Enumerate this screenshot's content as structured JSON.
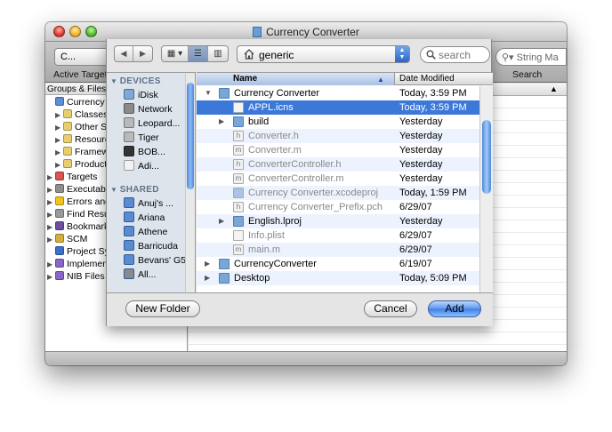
{
  "window": {
    "title": "Currency Converter"
  },
  "toolbar": {
    "target_popup": "C...",
    "target_label": "Active Target",
    "search_field_placeholder": "String Ma",
    "search_label": "Search"
  },
  "groups": {
    "header": "Groups & Files",
    "items": [
      {
        "label": "Currency Converter",
        "indent": 0,
        "color": "#5b8ed6",
        "tri": ""
      },
      {
        "label": "Classes",
        "indent": 1,
        "color": "#e8cf6e",
        "tri": "▶"
      },
      {
        "label": "Other Sources",
        "indent": 1,
        "color": "#e8cf6e",
        "tri": "▶"
      },
      {
        "label": "Resources",
        "indent": 1,
        "color": "#e8cf6e",
        "tri": "▶"
      },
      {
        "label": "Frameworks",
        "indent": 1,
        "color": "#e8cf6e",
        "tri": "▶"
      },
      {
        "label": "Products",
        "indent": 1,
        "color": "#e8cf6e",
        "tri": "▶"
      },
      {
        "label": "Targets",
        "indent": 0,
        "color": "#d9534f",
        "tri": "▶"
      },
      {
        "label": "Executables",
        "indent": 0,
        "color": "#8e8e8e",
        "tri": "▶"
      },
      {
        "label": "Errors and Warnings",
        "indent": 0,
        "color": "#f0c419",
        "tri": "▶"
      },
      {
        "label": "Find Results",
        "indent": 0,
        "color": "#999999",
        "tri": "▶"
      },
      {
        "label": "Bookmarks",
        "indent": 0,
        "color": "#6d4ea0",
        "tri": "▶"
      },
      {
        "label": "SCM",
        "indent": 0,
        "color": "#d4b03a",
        "tri": "▶"
      },
      {
        "label": "Project Symbols",
        "indent": 0,
        "color": "#3c6fc7",
        "tri": ""
      },
      {
        "label": "Implementation Files",
        "indent": 0,
        "color": "#8a65c7",
        "tri": "▶"
      },
      {
        "label": "NIB Files",
        "indent": 0,
        "color": "#8a65c7",
        "tri": "▶"
      }
    ]
  },
  "sheet": {
    "nav": {
      "back": "◀",
      "forward": "▶"
    },
    "view_modes": [
      "icon",
      "list",
      "column"
    ],
    "path": "generic",
    "search_placeholder": "search",
    "sidebar": {
      "devices_header": "DEVICES",
      "devices": [
        {
          "label": "iDisk",
          "color": "#7fa8d8",
          "eject": false
        },
        {
          "label": "Network",
          "color": "#8a8a8a",
          "eject": false
        },
        {
          "label": "Leopard...",
          "color": "#b9b9b9",
          "eject": false
        },
        {
          "label": "Tiger",
          "color": "#b9b9b9",
          "eject": false
        },
        {
          "label": "BOB...",
          "color": "#333333",
          "eject": true
        },
        {
          "label": "Adi...",
          "color": "#f2f2f2",
          "eject": true
        }
      ],
      "shared_header": "SHARED",
      "shared": [
        {
          "label": "Anuj's ...",
          "color": "#5a8ad0"
        },
        {
          "label": "Ariana",
          "color": "#5a8ad0"
        },
        {
          "label": "Athene",
          "color": "#5a8ad0"
        },
        {
          "label": "Barricuda",
          "color": "#5a8ad0"
        },
        {
          "label": "Bevans' G5",
          "color": "#5a8ad0"
        },
        {
          "label": "All...",
          "color": "#8a8a8a"
        }
      ]
    },
    "columns": {
      "name": "Name",
      "date": "Date Modified"
    },
    "files": [
      {
        "name": "Currency Converter",
        "date": "Today, 3:59 PM",
        "level": 0,
        "tri": "▼",
        "kind": "folder",
        "enabled": true,
        "selected": false
      },
      {
        "name": "APPL.icns",
        "date": "Today, 3:59 PM",
        "level": 1,
        "tri": "",
        "kind": "file",
        "enabled": true,
        "selected": true
      },
      {
        "name": "build",
        "date": "Yesterday",
        "level": 1,
        "tri": "▶",
        "kind": "folder",
        "enabled": true,
        "selected": false
      },
      {
        "name": "Converter.h",
        "date": "Yesterday",
        "level": 1,
        "tri": "",
        "kind": "h",
        "enabled": false,
        "selected": false
      },
      {
        "name": "Converter.m",
        "date": "Yesterday",
        "level": 1,
        "tri": "",
        "kind": "m",
        "enabled": false,
        "selected": false
      },
      {
        "name": "ConverterController.h",
        "date": "Yesterday",
        "level": 1,
        "tri": "",
        "kind": "h",
        "enabled": false,
        "selected": false
      },
      {
        "name": "ConverterController.m",
        "date": "Yesterday",
        "level": 1,
        "tri": "",
        "kind": "m",
        "enabled": false,
        "selected": false
      },
      {
        "name": "Currency Converter.xcodeproj",
        "date": "Today, 1:59 PM",
        "level": 1,
        "tri": "",
        "kind": "proj",
        "enabled": false,
        "selected": false
      },
      {
        "name": "Currency Converter_Prefix.pch",
        "date": "6/29/07",
        "level": 1,
        "tri": "",
        "kind": "h",
        "enabled": false,
        "selected": false
      },
      {
        "name": "English.lproj",
        "date": "Yesterday",
        "level": 1,
        "tri": "▶",
        "kind": "folder",
        "enabled": true,
        "selected": false
      },
      {
        "name": "Info.plist",
        "date": "6/29/07",
        "level": 1,
        "tri": "",
        "kind": "file",
        "enabled": false,
        "selected": false
      },
      {
        "name": "main.m",
        "date": "6/29/07",
        "level": 1,
        "tri": "",
        "kind": "m",
        "enabled": false,
        "selected": false
      },
      {
        "name": "CurrencyConverter",
        "date": "6/19/07",
        "level": 0,
        "tri": "▶",
        "kind": "folder",
        "enabled": true,
        "selected": false
      },
      {
        "name": "Desktop",
        "date": "Today, 5:09 PM",
        "level": 0,
        "tri": "▶",
        "kind": "folder",
        "enabled": true,
        "selected": false
      }
    ],
    "buttons": {
      "new_folder": "New Folder",
      "cancel": "Cancel",
      "add": "Add"
    }
  }
}
